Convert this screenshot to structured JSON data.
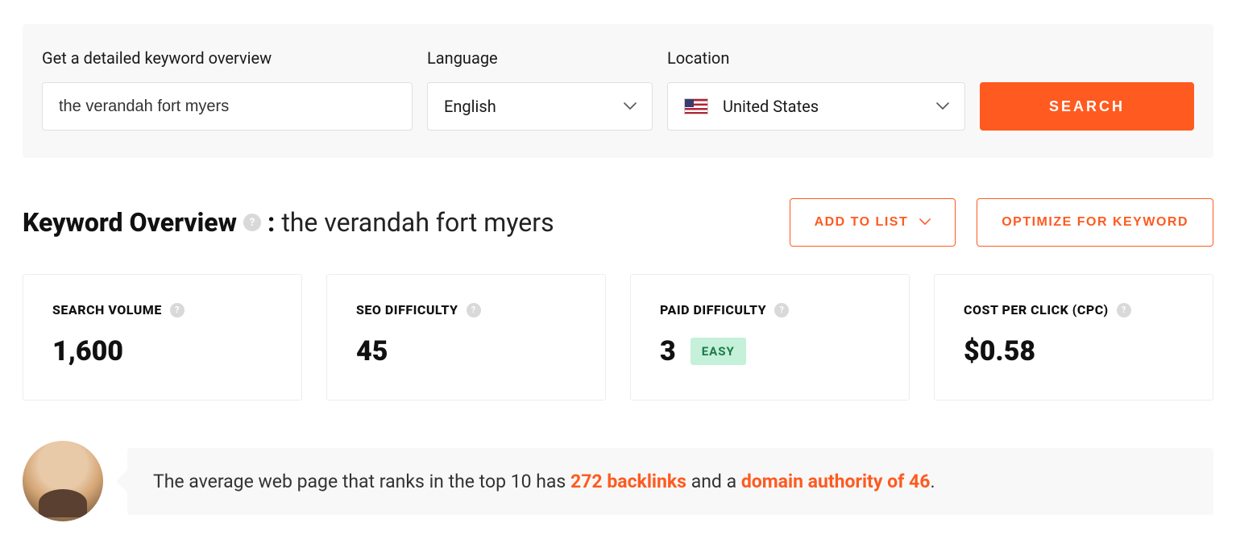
{
  "search": {
    "keyword_label": "Get a detailed keyword overview",
    "keyword_value": "the verandah fort myers",
    "language_label": "Language",
    "language_value": "English",
    "location_label": "Location",
    "location_value": "United States",
    "button": "SEARCH"
  },
  "overview": {
    "title_prefix": "Keyword Overview",
    "title_sep": ":",
    "keyword": "the verandah fort myers",
    "add_to_list": "ADD TO LIST",
    "optimize": "OPTIMIZE FOR KEYWORD"
  },
  "metrics": {
    "search_volume": {
      "label": "SEARCH VOLUME",
      "value": "1,600"
    },
    "seo_difficulty": {
      "label": "SEO DIFFICULTY",
      "value": "45"
    },
    "paid_difficulty": {
      "label": "PAID DIFFICULTY",
      "value": "3",
      "badge": "EASY"
    },
    "cpc": {
      "label": "COST PER CLICK (CPC)",
      "value": "$0.58"
    }
  },
  "insight": {
    "pre": "The average web page that ranks in the top 10 has ",
    "backlinks": "272 backlinks",
    "mid": " and a ",
    "authority": "domain authority of 46",
    "post": "."
  },
  "help_glyph": "?"
}
